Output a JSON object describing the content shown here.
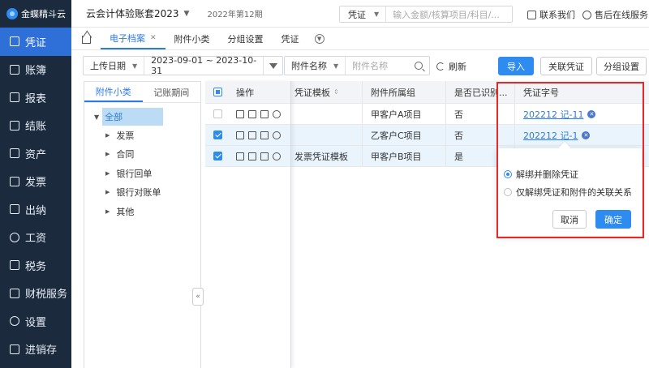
{
  "sidebar": {
    "logo": "金蝶精斗云",
    "items": [
      {
        "label": "凭证",
        "icon": "voucher-icon",
        "active": true
      },
      {
        "label": "账簿",
        "icon": "ledger-icon"
      },
      {
        "label": "报表",
        "icon": "report-icon"
      },
      {
        "label": "结账",
        "icon": "closing-icon"
      },
      {
        "label": "资产",
        "icon": "asset-icon"
      },
      {
        "label": "发票",
        "icon": "invoice-icon"
      },
      {
        "label": "出纳",
        "icon": "cashier-icon"
      },
      {
        "label": "工资",
        "icon": "salary-icon"
      },
      {
        "label": "税务",
        "icon": "tax-icon"
      },
      {
        "label": "财税服务",
        "icon": "service-icon"
      },
      {
        "label": "设置",
        "icon": "settings-icon"
      },
      {
        "label": "进销存",
        "icon": "inventory-icon"
      }
    ]
  },
  "topbar": {
    "account": "云会计体验账套2023",
    "period": "2022年第12期",
    "search_type": "凭证",
    "search_placeholder": "输入金额/核算项目/科目/...",
    "contact": "联系我们",
    "support": "售后在线服务"
  },
  "tabs": [
    {
      "label": "电子档案",
      "active": true,
      "closable": true
    },
    {
      "label": "附件小类"
    },
    {
      "label": "分组设置"
    },
    {
      "label": "凭证"
    }
  ],
  "filter": {
    "date_label": "上传日期",
    "date_range": "2023-09-01 ~ 2023-10-31",
    "attachment_label": "附件名称",
    "attachment_placeholder": "附件名称",
    "refresh": "刷新",
    "import": "导入",
    "link_voucher": "关联凭证",
    "group_settings": "分组设置"
  },
  "left_panel": {
    "tabs": [
      "附件小类",
      "记账期间"
    ],
    "root": "全部",
    "nodes": [
      "发票",
      "合同",
      "银行回单",
      "银行对账单",
      "其他"
    ]
  },
  "table": {
    "headers": {
      "op": "操作",
      "template": "凭证模板",
      "group": "附件所属组",
      "recognized": "是否已识别...",
      "voucher_no": "凭证字号"
    },
    "rows": [
      {
        "checked": false,
        "template": "",
        "group": "甲客户A项目",
        "recognized": "否",
        "voucher_no": "202212 记-11"
      },
      {
        "checked": true,
        "template": "",
        "group": "乙客户C项目",
        "recognized": "否",
        "voucher_no": "202212 记-1"
      },
      {
        "checked": true,
        "template": "发票凭证模板",
        "group": "甲客户B项目",
        "recognized": "是",
        "voucher_no": ""
      }
    ]
  },
  "popover": {
    "option1": "解绑并删除凭证",
    "option2": "仅解绑凭证和附件的关联关系",
    "cancel": "取消",
    "confirm": "确定"
  },
  "colors": {
    "primary": "#2e8cf0",
    "sidebar_bg": "#1b2a3d",
    "highlight_border": "#e62828"
  }
}
